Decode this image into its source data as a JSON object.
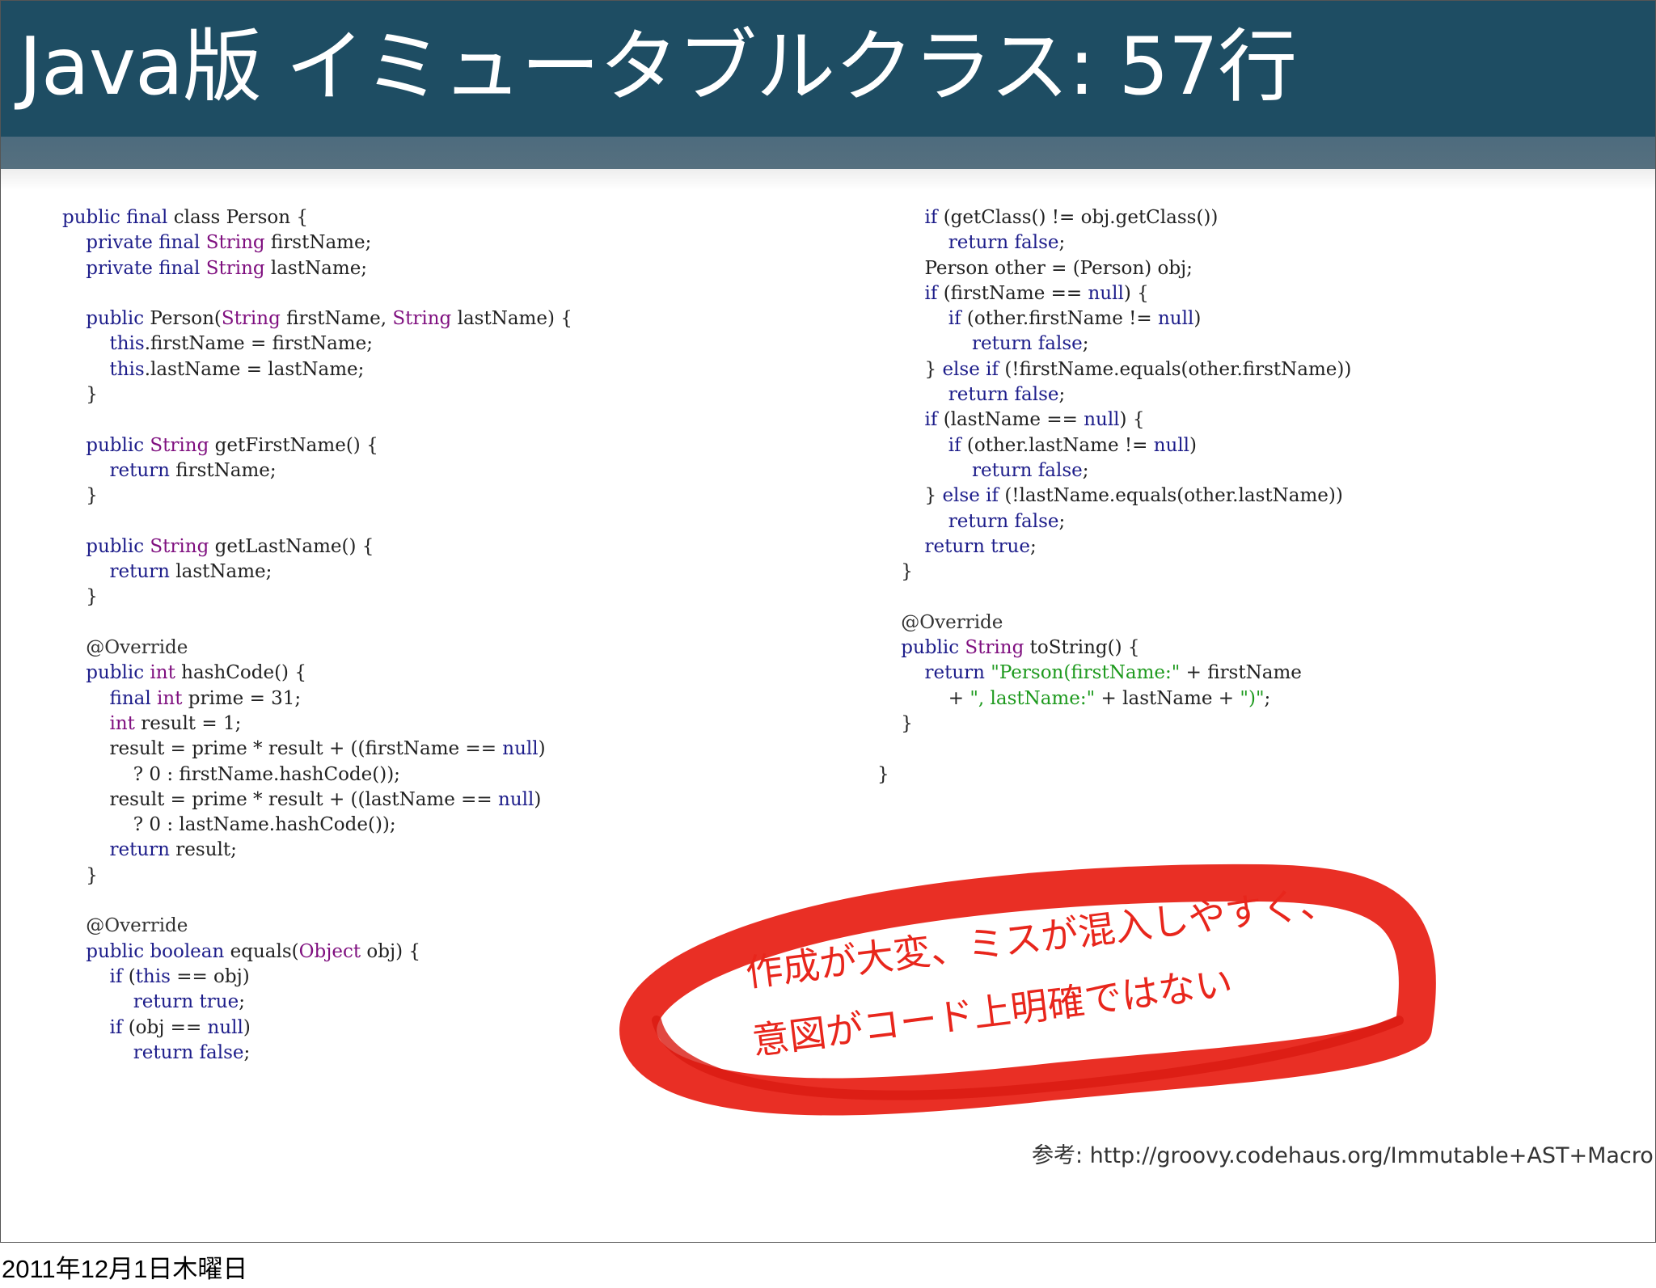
{
  "slide": {
    "title": "Java版 イミュータブルクラス: 57行",
    "note_lines": [
      "作成が大変、ミスが混入しやすく、",
      "意図がコード上明確ではない"
    ],
    "reference": "参考: http://groovy.codehaus.org/Immutable+AST+Macro",
    "colors": {
      "header": "#1e4d63",
      "strip": "#4d6b7e",
      "highlight": "#e8261c",
      "keyword": "#1d1d8a",
      "type": "#7f0f7f",
      "string": "#1e9a1e"
    }
  },
  "code": {
    "left": [
      [
        [
          "kw",
          "public final "
        ],
        [
          "",
          "class Person {"
        ]
      ],
      [
        [
          "",
          "    "
        ],
        [
          "kw",
          "private final "
        ],
        [
          "ty",
          "String"
        ],
        [
          "",
          " firstName;"
        ]
      ],
      [
        [
          "",
          "    "
        ],
        [
          "kw",
          "private final "
        ],
        [
          "ty",
          "String"
        ],
        [
          "",
          " lastName;"
        ]
      ],
      [],
      [
        [
          "",
          "    "
        ],
        [
          "kw",
          "public "
        ],
        [
          "",
          "Person("
        ],
        [
          "ty",
          "String"
        ],
        [
          "",
          " firstName, "
        ],
        [
          "ty",
          "String"
        ],
        [
          "",
          " lastName) {"
        ]
      ],
      [
        [
          "",
          "        "
        ],
        [
          "kw",
          "this"
        ],
        [
          "",
          ".firstName = firstName;"
        ]
      ],
      [
        [
          "",
          "        "
        ],
        [
          "kw",
          "this"
        ],
        [
          "",
          ".lastName = lastName;"
        ]
      ],
      [
        [
          "",
          "    }"
        ]
      ],
      [],
      [
        [
          "",
          "    "
        ],
        [
          "kw",
          "public "
        ],
        [
          "ty",
          "String"
        ],
        [
          "",
          " getFirstName() {"
        ]
      ],
      [
        [
          "",
          "        "
        ],
        [
          "kw",
          "return "
        ],
        [
          "",
          "firstName;"
        ]
      ],
      [
        [
          "",
          "    }"
        ]
      ],
      [],
      [
        [
          "",
          "    "
        ],
        [
          "kw",
          "public "
        ],
        [
          "ty",
          "String"
        ],
        [
          "",
          " getLastName() {"
        ]
      ],
      [
        [
          "",
          "        "
        ],
        [
          "kw",
          "return "
        ],
        [
          "",
          "lastName;"
        ]
      ],
      [
        [
          "",
          "    }"
        ]
      ],
      [],
      [
        [
          "",
          "    "
        ],
        [
          "an",
          "@Override"
        ]
      ],
      [
        [
          "",
          "    "
        ],
        [
          "kw",
          "public "
        ],
        [
          "ty",
          "int"
        ],
        [
          "",
          " hashCode() {"
        ]
      ],
      [
        [
          "",
          "        "
        ],
        [
          "kw",
          "final "
        ],
        [
          "ty",
          "int"
        ],
        [
          "",
          " prime = 31;"
        ]
      ],
      [
        [
          "",
          "        "
        ],
        [
          "ty",
          "int"
        ],
        [
          "",
          " result = 1;"
        ]
      ],
      [
        [
          "",
          "        result = prime * result + ((firstName == "
        ],
        [
          "kw",
          "null"
        ],
        [
          "",
          ")"
        ]
      ],
      [
        [
          "",
          "            ? 0 : firstName.hashCode());"
        ]
      ],
      [
        [
          "",
          "        result = prime * result + ((lastName == "
        ],
        [
          "kw",
          "null"
        ],
        [
          "",
          ")"
        ]
      ],
      [
        [
          "",
          "            ? 0 : lastName.hashCode());"
        ]
      ],
      [
        [
          "",
          "        "
        ],
        [
          "kw",
          "return "
        ],
        [
          "",
          "result;"
        ]
      ],
      [
        [
          "",
          "    }"
        ]
      ],
      [],
      [
        [
          "",
          "    "
        ],
        [
          "an",
          "@Override"
        ]
      ],
      [
        [
          "",
          "    "
        ],
        [
          "kw",
          "public boolean "
        ],
        [
          "",
          "equals("
        ],
        [
          "ty",
          "Object"
        ],
        [
          "",
          " obj) {"
        ]
      ],
      [
        [
          "",
          "        "
        ],
        [
          "kw",
          "if "
        ],
        [
          "",
          "("
        ],
        [
          "kw",
          "this"
        ],
        [
          "",
          " == obj)"
        ]
      ],
      [
        [
          "",
          "            "
        ],
        [
          "kw",
          "return true"
        ],
        [
          "",
          ";"
        ]
      ],
      [
        [
          "",
          "        "
        ],
        [
          "kw",
          "if "
        ],
        [
          "",
          "(obj == "
        ],
        [
          "kw",
          "null"
        ],
        [
          "",
          ")"
        ]
      ],
      [
        [
          "",
          "            "
        ],
        [
          "kw",
          "return false"
        ],
        [
          "",
          ";"
        ]
      ]
    ],
    "right": [
      [
        [
          "",
          "        "
        ],
        [
          "kw",
          "if "
        ],
        [
          "",
          "(getClass() != obj.getClass())"
        ]
      ],
      [
        [
          "",
          "            "
        ],
        [
          "kw",
          "return false"
        ],
        [
          "",
          ";"
        ]
      ],
      [
        [
          "",
          "        Person other = (Person) obj;"
        ]
      ],
      [
        [
          "",
          "        "
        ],
        [
          "kw",
          "if "
        ],
        [
          "",
          "(firstName == "
        ],
        [
          "kw",
          "null"
        ],
        [
          "",
          ") {"
        ]
      ],
      [
        [
          "",
          "            "
        ],
        [
          "kw",
          "if "
        ],
        [
          "",
          "(other.firstName != "
        ],
        [
          "kw",
          "null"
        ],
        [
          "",
          ")"
        ]
      ],
      [
        [
          "",
          "                "
        ],
        [
          "kw",
          "return false"
        ],
        [
          "",
          ";"
        ]
      ],
      [
        [
          "",
          "        } "
        ],
        [
          "kw",
          "else if "
        ],
        [
          "",
          "(!firstName.equals(other.firstName))"
        ]
      ],
      [
        [
          "",
          "            "
        ],
        [
          "kw",
          "return false"
        ],
        [
          "",
          ";"
        ]
      ],
      [
        [
          "",
          "        "
        ],
        [
          "kw",
          "if "
        ],
        [
          "",
          "(lastName == "
        ],
        [
          "kw",
          "null"
        ],
        [
          "",
          ") {"
        ]
      ],
      [
        [
          "",
          "            "
        ],
        [
          "kw",
          "if "
        ],
        [
          "",
          "(other.lastName != "
        ],
        [
          "kw",
          "null"
        ],
        [
          "",
          ")"
        ]
      ],
      [
        [
          "",
          "                "
        ],
        [
          "kw",
          "return false"
        ],
        [
          "",
          ";"
        ]
      ],
      [
        [
          "",
          "        } "
        ],
        [
          "kw",
          "else if "
        ],
        [
          "",
          "(!lastName.equals(other.lastName))"
        ]
      ],
      [
        [
          "",
          "            "
        ],
        [
          "kw",
          "return false"
        ],
        [
          "",
          ";"
        ]
      ],
      [
        [
          "",
          "        "
        ],
        [
          "kw",
          "return true"
        ],
        [
          "",
          ";"
        ]
      ],
      [
        [
          "",
          "    }"
        ]
      ],
      [],
      [
        [
          "",
          "    "
        ],
        [
          "an",
          "@Override"
        ]
      ],
      [
        [
          "",
          "    "
        ],
        [
          "kw",
          "public "
        ],
        [
          "ty",
          "String"
        ],
        [
          "",
          " toString() {"
        ]
      ],
      [
        [
          "",
          "        "
        ],
        [
          "kw",
          "return "
        ],
        [
          "st",
          "\"Person(firstName:\""
        ],
        [
          "",
          " + firstName"
        ]
      ],
      [
        [
          "",
          "            + "
        ],
        [
          "st",
          "\", lastName:\""
        ],
        [
          "",
          " + lastName + "
        ],
        [
          "st",
          "\")\""
        ],
        [
          "",
          ";"
        ]
      ],
      [
        [
          "",
          "    }"
        ]
      ],
      [],
      [
        [
          "",
          "}"
        ]
      ]
    ]
  },
  "footer": {
    "date": "2011年12月1日木曜日"
  }
}
